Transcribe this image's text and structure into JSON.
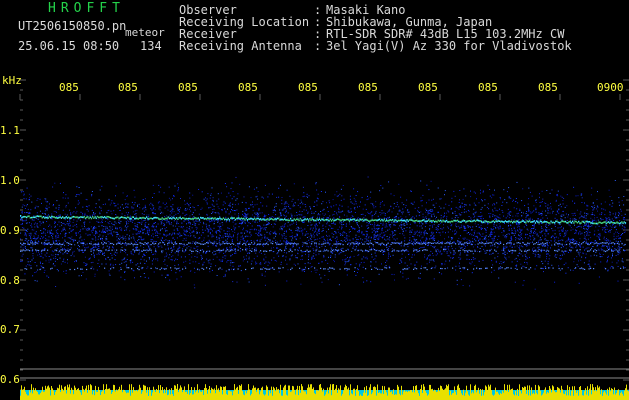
{
  "header": {
    "title": "HROFFT",
    "filename": "UT2506150850.pn",
    "mode": "meteor",
    "timestamp": "25.06.15 08:50",
    "count": "134"
  },
  "info": [
    {
      "label": "Observer",
      "value": "Masaki Kano"
    },
    {
      "label": "Receiving Location",
      "value": "Shibukawa, Gunma, Japan"
    },
    {
      "label": "Receiver",
      "value": "RTL-SDR SDR# 43dB L15 103.2MHz CW"
    },
    {
      "label": "Receiving Antenna",
      "value": "3el Yagi(V) Az 330 for Vladivostok"
    }
  ],
  "axis": {
    "unit": "kHz",
    "time_labels": [
      "085",
      "085",
      "085",
      "085",
      "085",
      "085",
      "085",
      "085",
      "085",
      "0900"
    ],
    "freq_labels": [
      "1.1",
      "1.0",
      "0.9",
      "0.8",
      "0.7",
      "0.6"
    ]
  },
  "colors": {
    "background": "#000000",
    "text": "#d9d9d9",
    "title": "#24d24a",
    "axis": "#ffff40",
    "tick": "#5a5a5a"
  }
}
